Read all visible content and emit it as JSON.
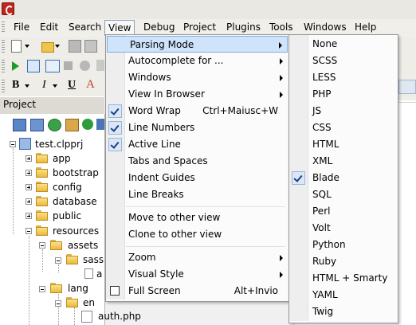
{
  "menubar": {
    "items": [
      {
        "label": "File"
      },
      {
        "label": "Edit"
      },
      {
        "label": "Search"
      },
      {
        "label": "View"
      },
      {
        "label": "Debug"
      },
      {
        "label": "Project"
      },
      {
        "label": "Plugins"
      },
      {
        "label": "Tools"
      },
      {
        "label": "Windows"
      },
      {
        "label": "Help"
      }
    ]
  },
  "project_panel": {
    "title": "Project",
    "tree": [
      {
        "label": "test.clpprj"
      },
      {
        "label": "app"
      },
      {
        "label": "bootstrap"
      },
      {
        "label": "config"
      },
      {
        "label": "database"
      },
      {
        "label": "public"
      },
      {
        "label": "resources"
      },
      {
        "label": "assets"
      },
      {
        "label": "sass"
      },
      {
        "label": "a"
      },
      {
        "label": "lang"
      },
      {
        "label": "en"
      },
      {
        "label": "auth.php"
      }
    ]
  },
  "view_menu": {
    "items": [
      {
        "label": "Parsing Mode",
        "submenu": true,
        "highlighted": true
      },
      {
        "label": "Autocomplete for ...",
        "submenu": true
      },
      {
        "label": "Windows",
        "submenu": true
      },
      {
        "label": "View In Browser",
        "submenu": true
      },
      {
        "label": "Word Wrap",
        "shortcut": "Ctrl+Maiusc+W",
        "checked": true
      },
      {
        "label": "Line Numbers",
        "checked": true
      },
      {
        "label": "Active Line",
        "checked": true
      },
      {
        "label": "Tabs and Spaces"
      },
      {
        "label": "Indent Guides"
      },
      {
        "label": "Line Breaks"
      },
      {
        "label": "Move to other view"
      },
      {
        "label": "Clone to other view"
      },
      {
        "label": "Zoom",
        "submenu": true
      },
      {
        "label": "Visual Style",
        "submenu": true
      },
      {
        "label": "Full Screen",
        "shortcut": "Alt+Invio"
      }
    ]
  },
  "parsing_mode_submenu": {
    "items": [
      {
        "label": "None"
      },
      {
        "label": "SCSS"
      },
      {
        "label": "LESS"
      },
      {
        "label": "PHP"
      },
      {
        "label": "JS"
      },
      {
        "label": "CSS"
      },
      {
        "label": "HTML"
      },
      {
        "label": "XML"
      },
      {
        "label": "Blade",
        "checked": true
      },
      {
        "label": "SQL"
      },
      {
        "label": "Perl"
      },
      {
        "label": "Volt"
      },
      {
        "label": "Python"
      },
      {
        "label": "Ruby"
      },
      {
        "label": "HTML + Smarty"
      },
      {
        "label": "YAML"
      },
      {
        "label": "Twig"
      }
    ]
  },
  "colors": {
    "highlight": "#cfe3fb",
    "highlight_border": "#84acdd",
    "check_mark": "#1d3e83",
    "app_icon": "#c0251c"
  }
}
